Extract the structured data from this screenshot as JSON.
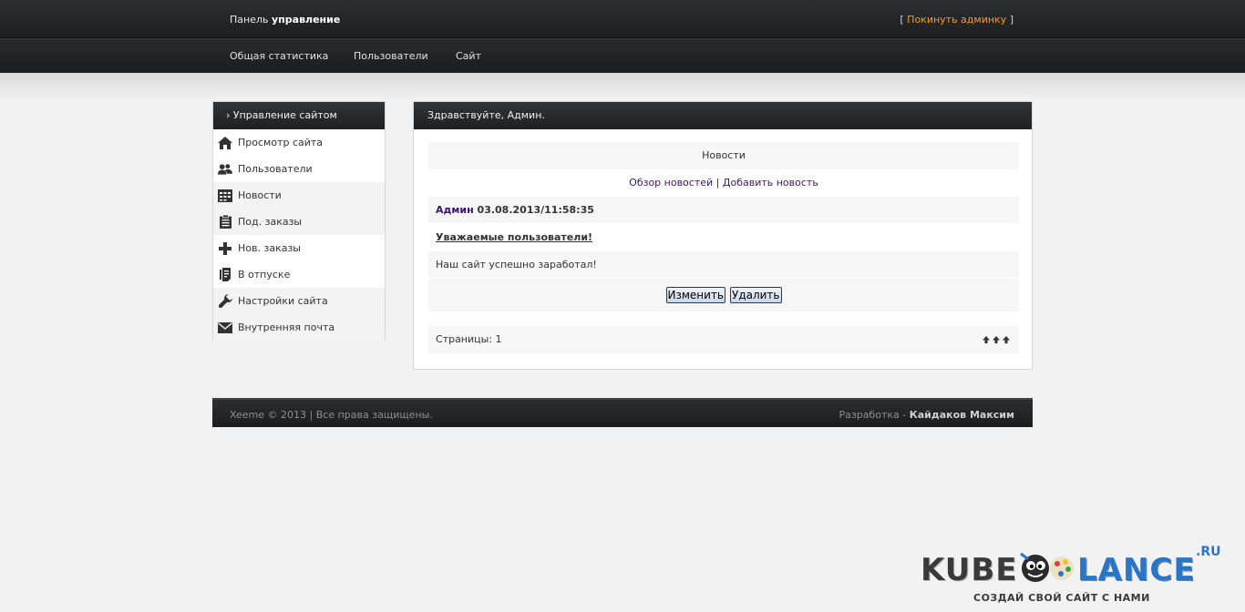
{
  "header": {
    "brand_prefix": "Панель",
    "brand_bold": "управление",
    "exit_open": "[",
    "exit_label": "Покинуть админку",
    "exit_close": "]"
  },
  "nav": {
    "items": [
      {
        "label": "Общая статистика"
      },
      {
        "label": "Пользователи"
      },
      {
        "label": "Сайт"
      }
    ]
  },
  "sidebar": {
    "title": "› Управление сайтом",
    "items": [
      {
        "label": "Просмотр сайта",
        "icon": "home-icon"
      },
      {
        "label": "Пользователи",
        "icon": "users-icon"
      },
      {
        "label": "Новости",
        "icon": "news-icon"
      },
      {
        "label": "Под. заказы",
        "icon": "clipboard-icon"
      },
      {
        "label": "Нов. заказы",
        "icon": "plus-icon"
      },
      {
        "label": "В отпуске",
        "icon": "document-icon"
      },
      {
        "label": "Настройки сайта",
        "icon": "wrench-icon"
      },
      {
        "label": "Внутренняя почта",
        "icon": "mail-icon"
      }
    ]
  },
  "main": {
    "greeting": "Здравствуйте, Админ.",
    "section_title": "Новости",
    "links": {
      "overview": "Обзор новостей",
      "separator": " | ",
      "add": "Добавить новость"
    },
    "post": {
      "author": "Админ",
      "datetime": "03.08.2013/11:58:35",
      "subject": "Уважаемые пользователи!",
      "body": "Наш сайт успешно заработал!",
      "edit_label": "Изменить",
      "delete_label": "Удалить"
    },
    "pages_label": "Страницы: 1"
  },
  "footer": {
    "copyright": "Xeeme © 2013 | Все права защищены.",
    "dev_prefix": "Разработка - ",
    "dev_name": "Кайдаков Максим"
  },
  "watermark": {
    "word_left": "KUBE",
    "word_right": "LANCE",
    "tld": ".RU",
    "slogan": "СОЗДАЙ СВОЙ САЙТ С НАМИ"
  },
  "colors": {
    "accent_link": "#f39a24",
    "news_link": "#3a1a6b",
    "header_bg": "#222325",
    "logo_blue": "#2a76c4"
  }
}
